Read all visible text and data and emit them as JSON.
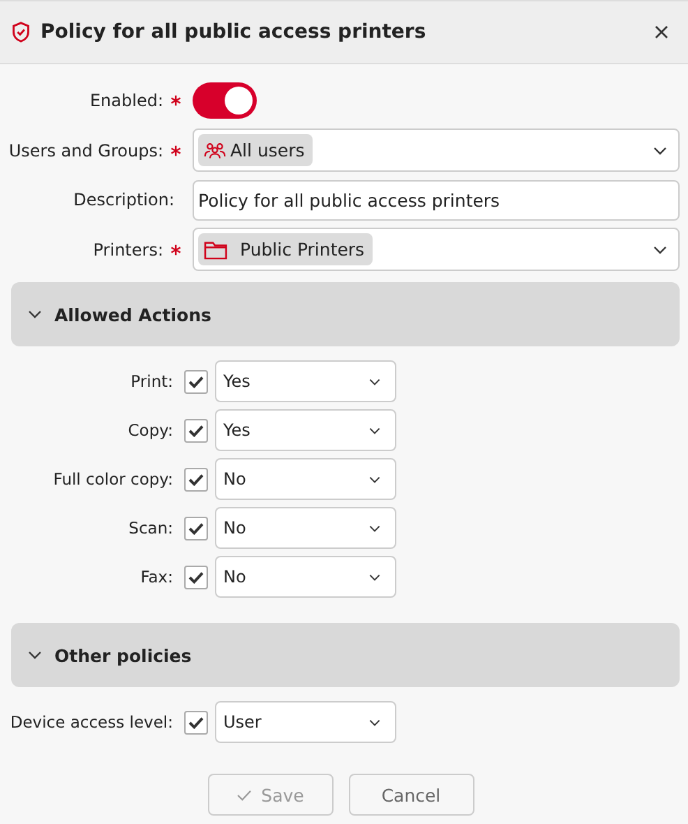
{
  "dialog": {
    "title": "Policy for all public access printers"
  },
  "fields": [
    {
      "kind": "toggle",
      "label": "Enabled:",
      "required": true,
      "on": true
    },
    {
      "kind": "user-picker",
      "label": "Users and Groups:",
      "required": true,
      "chip": "All users"
    },
    {
      "kind": "text",
      "label": "Description:",
      "required": false,
      "value": "Policy for all public access printers"
    },
    {
      "kind": "printer-picker",
      "label": "Printers:",
      "required": true,
      "chip": "Public Printers"
    }
  ],
  "sections": [
    {
      "title": "Allowed Actions",
      "expanded": true,
      "rows": [
        {
          "label": "Print:",
          "checked": true,
          "value": "Yes"
        },
        {
          "label": "Copy:",
          "checked": true,
          "value": "Yes"
        },
        {
          "label": "Full color copy:",
          "checked": true,
          "value": "No"
        },
        {
          "label": "Scan:",
          "checked": true,
          "value": "No"
        },
        {
          "label": "Fax:",
          "checked": true,
          "value": "No"
        }
      ]
    },
    {
      "title": "Other policies",
      "expanded": true,
      "rows": [
        {
          "label": "Device access level:",
          "checked": true,
          "value": "User"
        }
      ]
    }
  ],
  "buttons": [
    {
      "label": "Save",
      "kind": "save",
      "disabled": true
    },
    {
      "label": "Cancel",
      "kind": "cancel",
      "disabled": false
    }
  ]
}
